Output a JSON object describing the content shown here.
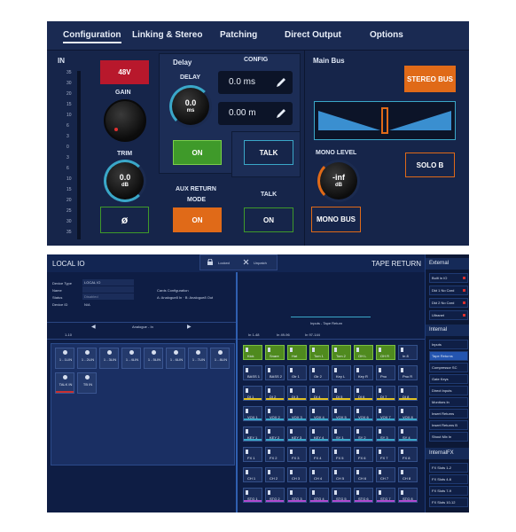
{
  "top": {
    "tabs": [
      "Configuration",
      "Linking & Stereo",
      "Patching",
      "Direct Output",
      "Options"
    ],
    "in_label": "IN",
    "meter_ticks": [
      "35",
      "30",
      "20",
      "15",
      "10",
      "6",
      "3",
      "0",
      "3",
      "6",
      "10",
      "15",
      "20",
      "25",
      "30",
      "35"
    ],
    "phantom_label": "48V",
    "gain_label": "GAIN",
    "trim_label": "TRIM",
    "trim_value": "0.0",
    "trim_unit": "dB",
    "phase_symbol": "ø",
    "delay_section": "Delay",
    "delay_label": "DELAY",
    "delay_value": "0.0",
    "delay_unit": "ms",
    "config_label": "CONFIG",
    "delay_ms_value": "0.0 ms",
    "delay_m_value": "0.00 m",
    "delay_on": "ON",
    "talk_label": "TALK",
    "aux_return_mode_line1": "AUX RETURN",
    "aux_return_mode_line2": "MODE",
    "aux_on": "ON",
    "talk_heading": "TALK",
    "talk_on": "ON",
    "main_bus": "Main Bus",
    "stereo_bus": "STEREO BUS",
    "mono_level": "MONO LEVEL",
    "mono_value": "-inf",
    "mono_unit": "dB",
    "solo_b": "SOLO B",
    "mono_bus": "MONO BUS"
  },
  "bottom": {
    "title": "LOCAL IO",
    "tape_return": "TAPE RETURN",
    "locked": "Locked",
    "unpatch": "Unpatch",
    "device_type_label": "Device Type",
    "device_type_value": "LOCAL IO",
    "name_label": "Name",
    "status_label": "Status",
    "status_value": "Disabled",
    "device_id_label": "Device ID",
    "device_id_value": "N/A",
    "cards_config_label": "Cards Configuration",
    "cards_config_value": "A: Analogue8 In · B: Analogue8 Out",
    "analogue_in": "Analogue - In",
    "range_left": "1-10",
    "inputs_tape": "Inputs - Tape Return",
    "range_tabs": [
      "In 1-48",
      "In 49-96",
      "In 97-144"
    ],
    "slots_row1": [
      "1 - 1LIN",
      "1 - 2LIN",
      "1 - 3LIN",
      "1 - 4LIN",
      "1 - 5LIN",
      "1 - 6LIN",
      "1 - 7LIN",
      "1 - 8LIN"
    ],
    "slots_row2": [
      "TALK IN",
      "TB IN"
    ],
    "cells": [
      [
        "Kick",
        "Snare",
        "Hat",
        "Tom 1",
        "Tom 2",
        "OH L",
        "OH R",
        "In 8"
      ],
      [
        "BASS 1",
        "BASS 2",
        "Gtr 1",
        "Gtr 2",
        "Key L",
        "Key R",
        "Pno",
        "Pno R"
      ],
      [
        "DI 1",
        "DI 2",
        "DI 3",
        "DI 4",
        "DI 5",
        "DI 6",
        "DI 7",
        "DI 8"
      ],
      [
        "VOX 1",
        "VOX 2",
        "VOX 3",
        "VOX 4",
        "VOX 5",
        "VOX 6",
        "VOX 7",
        "VOX 8"
      ],
      [
        "KEY 1",
        "KEY 2",
        "KEY 3",
        "KEY 4",
        "SY 1",
        "SY 2",
        "SY 3",
        "SY 4"
      ],
      [
        "FX 1",
        "FX 2",
        "FX 3",
        "FX 4",
        "FX 5",
        "FX 6",
        "FX 7",
        "FX 8"
      ],
      [
        "CH 1",
        "CH 2",
        "CH 3",
        "CH 4",
        "CH 5",
        "CH 6",
        "CH 7",
        "CH 8"
      ],
      [
        "STG 1",
        "STG 2",
        "STG 3",
        "STG 4",
        "STG 5",
        "STG 6",
        "STG 7",
        "STG 8"
      ]
    ],
    "side": {
      "external": "External",
      "external_items": [
        "Built in IO",
        "Dkt 1 No Card",
        "Dkt 2 No Card",
        "Ultranet"
      ],
      "internal": "Internal",
      "internal_items": [
        "Inputs",
        "Tape Returns",
        "Compressor SC",
        "Gate Keys",
        "Direct Inputs",
        "Monitors In",
        "Insert Returns",
        "Insert Returns B",
        "Shout Mix In"
      ],
      "internalfx": "InternalFX",
      "fx_items": [
        "FX Slots 1-2",
        "FX Slots 4-6",
        "FX Slots 7-9",
        "FX Slots 10-12"
      ]
    }
  },
  "colors": {
    "panel_bg": "#16254a",
    "red": "#b8182c",
    "green": "#3f9a2a",
    "orange": "#e06a18",
    "teal": "#3aa7c8"
  }
}
